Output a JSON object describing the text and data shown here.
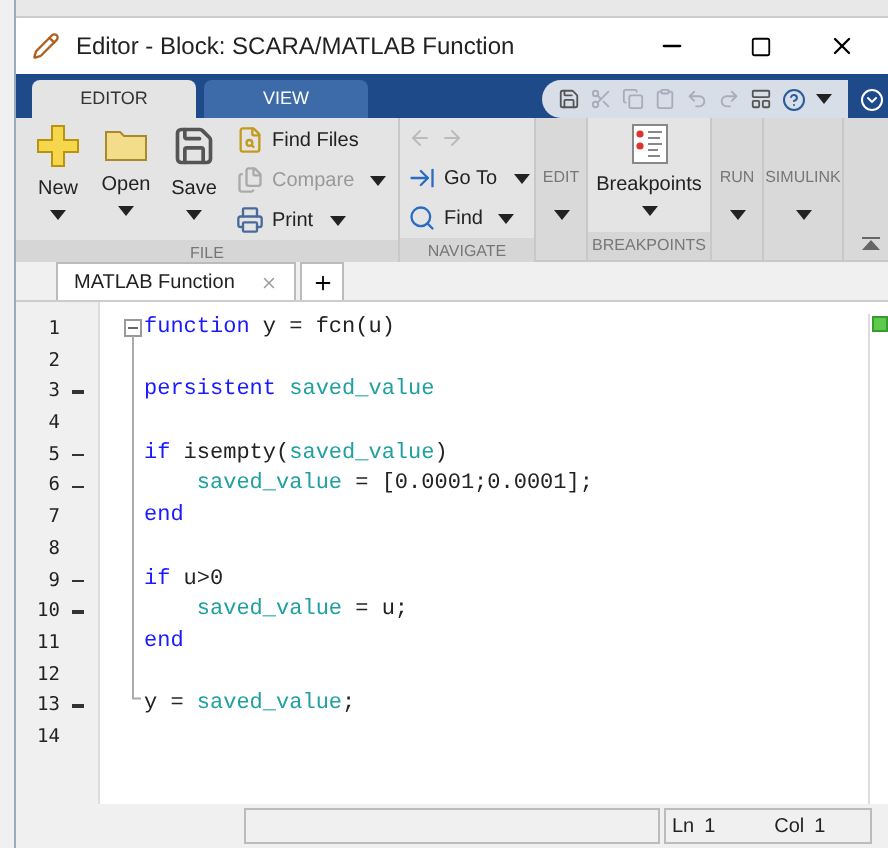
{
  "window": {
    "title": "Editor - Block: SCARA/MATLAB Function"
  },
  "ribbon_tabs": [
    {
      "label": "EDITOR",
      "selected": true
    },
    {
      "label": "VIEW",
      "selected": false
    }
  ],
  "ribbon": {
    "file": {
      "label": "FILE",
      "big_buttons": [
        {
          "kind": "new",
          "label": "New"
        },
        {
          "kind": "open",
          "label": "Open"
        },
        {
          "kind": "save",
          "label": "Save"
        }
      ],
      "small_buttons": [
        {
          "kind": "find_files",
          "label": "Find Files",
          "disabled": false,
          "dropdown": false
        },
        {
          "kind": "compare",
          "label": "Compare",
          "disabled": true,
          "dropdown": true
        },
        {
          "kind": "print",
          "label": "Print",
          "disabled": false,
          "dropdown": true
        }
      ]
    },
    "navigate": {
      "label": "NAVIGATE",
      "small_buttons": [
        {
          "kind": "goto",
          "label": "Go To",
          "disabled": false,
          "dropdown": true
        },
        {
          "kind": "find",
          "label": "Find",
          "disabled": false,
          "dropdown": true
        }
      ]
    },
    "edit": {
      "label": "EDIT"
    },
    "breakpoints": {
      "label": "BREAKPOINTS",
      "button": "Breakpoints"
    },
    "run": {
      "label": "RUN"
    },
    "simulink": {
      "label": "SIMULINK"
    }
  },
  "document_tabs": [
    {
      "label": "MATLAB Function",
      "selected": true
    }
  ],
  "code_lines": [
    {
      "number": "1",
      "executable": false,
      "tokens": [
        {
          "kind": "keyword",
          "text": "function"
        },
        {
          "kind": "plain",
          "text": " y = fcn(u)"
        }
      ]
    },
    {
      "number": "2",
      "executable": false
    },
    {
      "number": "3",
      "executable": true,
      "tokens": [
        {
          "kind": "keyword",
          "text": "persistent"
        },
        {
          "kind": "variable",
          "text": " saved_value"
        }
      ]
    },
    {
      "number": "4",
      "executable": false
    },
    {
      "number": "5",
      "executable": true,
      "tokens": [
        {
          "kind": "keyword",
          "text": "if"
        },
        {
          "kind": "plain",
          "text": " isempty("
        },
        {
          "kind": "variable",
          "text": "saved_value"
        },
        {
          "kind": "plain",
          "text": ")"
        }
      ]
    },
    {
      "number": "6",
      "executable": true,
      "tokens": [
        {
          "kind": "variable",
          "text": "    saved_value"
        },
        {
          "kind": "plain",
          "text": " = [0.0001;0.0001];"
        }
      ]
    },
    {
      "number": "7",
      "executable": false,
      "tokens": [
        {
          "kind": "keyword",
          "text": "end"
        }
      ]
    },
    {
      "number": "8",
      "executable": false
    },
    {
      "number": "9",
      "executable": true,
      "tokens": [
        {
          "kind": "keyword",
          "text": "if"
        },
        {
          "kind": "plain",
          "text": " u>0"
        }
      ]
    },
    {
      "number": "10",
      "executable": true,
      "tokens": [
        {
          "kind": "variable",
          "text": "    saved_value"
        },
        {
          "kind": "plain",
          "text": " = u;"
        }
      ]
    },
    {
      "number": "11",
      "executable": false,
      "tokens": [
        {
          "kind": "keyword",
          "text": "end"
        }
      ]
    },
    {
      "number": "12",
      "executable": false
    },
    {
      "number": "13",
      "executable": true,
      "tokens": [
        {
          "kind": "plain",
          "text": "y = "
        },
        {
          "kind": "variable",
          "text": "saved_value"
        },
        {
          "kind": "plain",
          "text": ";"
        }
      ]
    },
    {
      "number": "14",
      "executable": false
    }
  ],
  "status_bar": {
    "line_label": "Ln",
    "line": "1",
    "column_label": "Col",
    "column": "1"
  }
}
